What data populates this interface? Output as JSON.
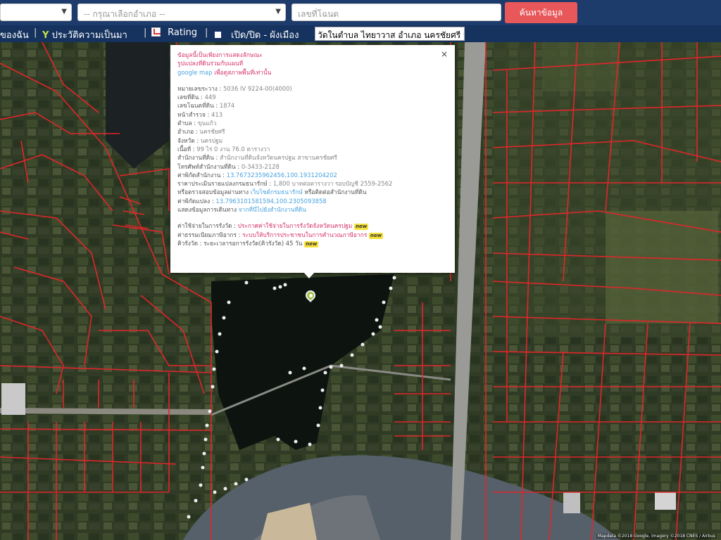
{
  "search": {
    "province_placeholder": "",
    "amphoe_placeholder": "-- กรุณาเลือกอำเภอ --",
    "parcel_placeholder": "เลขที่โฉนด",
    "search_button": "ค้นหาข้อมูล"
  },
  "toolbar": {
    "item_own": "ของฉัน",
    "sep": "|",
    "history": "ประวัติความเป็นมา",
    "rating": "Rating",
    "toggle_layer": "เปิด/ปิด - ผังเมือง",
    "location": "วัดในตำบล ไทยาวาส อำเภอ นครชัยศรี นครปฐม"
  },
  "popup": {
    "notice_1": "ข้อมูลนี้เป็นเพียงการแสดงลักษณะ",
    "notice_2": "รูปแปลงที่ดินร่วมกับแผนที่",
    "notice_3a": "google map ",
    "notice_3b": "เพื่อดูสภาพพื้นที่เท่านั้น",
    "rows": [
      {
        "label": "หมายเลขระวาง : ",
        "value": "5036 IV 9224-00(4000)"
      },
      {
        "label": "เลขที่ดิน : ",
        "value": "449"
      },
      {
        "label": "เลขโฉนดที่ดิน : ",
        "value": "1874"
      },
      {
        "label": "หน้าสำรวจ : ",
        "value": "413"
      },
      {
        "label": "ตำบล : ",
        "value": "ขุนแก้ว"
      },
      {
        "label": "อำเภอ : ",
        "value": "นครชัยศรี"
      },
      {
        "label": "จังหวัด : ",
        "value": "นครปฐม"
      },
      {
        "label": "เนื้อที่ : ",
        "value": "99 ไร่ 0 งาน 76.0 ตารางวา"
      },
      {
        "label": "สำนักงานที่ดิน : ",
        "value": "สำนักงานที่ดินจังหวัดนครปฐม สาขานครชัยศรี"
      },
      {
        "label": "โทรศัพท์สำนักงานที่ดิน : ",
        "value": "0-3433-2128"
      }
    ],
    "office_coord_label": "ค่าพิกัดสำนักงาน : ",
    "office_coord_value": "13.7673235962456,100.1931204202",
    "price_label": "ราคาประเมินรายแปลงกรมธนารักษ์ : ",
    "price_value": "1,800 บาทต่อตารางวา รอบบัญชี 2559-2562",
    "check_label": "หรือตรวจสอบข้อมูลผ่านทาง ",
    "check_link": "เว็บไซต์กรมธนารักษ์",
    "check_tail": " หรือติดต่อสำนักงานที่ดิน",
    "parcel_coord_label": "ค่าพิกัดแปลง : ",
    "parcel_coord_value": "13.7963101581594,100.2305093858",
    "route_label": "แสดงข้อมูลการเดินทาง ",
    "route_link": "จากที่นี่ไปยังสำนักงานที่ดิน",
    "fee_label": "ค่าใช้จ่ายในการรังวัด : ",
    "fee_link": "ประกาศค่าใช้จ่ายในการรังวัดจังหวัดนครปฐม",
    "tax_label": "ค่าธรรมเนียมภาษีอากร : ",
    "tax_link": "ระบบให้บริการประชาชนในการคำนวณภาษีอากร",
    "queue_label": "คิวรังวัด : ",
    "queue_value": "ระยะเวลารอการรังวัด(คิวรังวัด) 45 วัน",
    "badge": "new",
    "close": "×"
  },
  "map": {
    "copyright": "Mapdata ©2018 Google, Imagery ©2018 CNES / Airbus"
  }
}
